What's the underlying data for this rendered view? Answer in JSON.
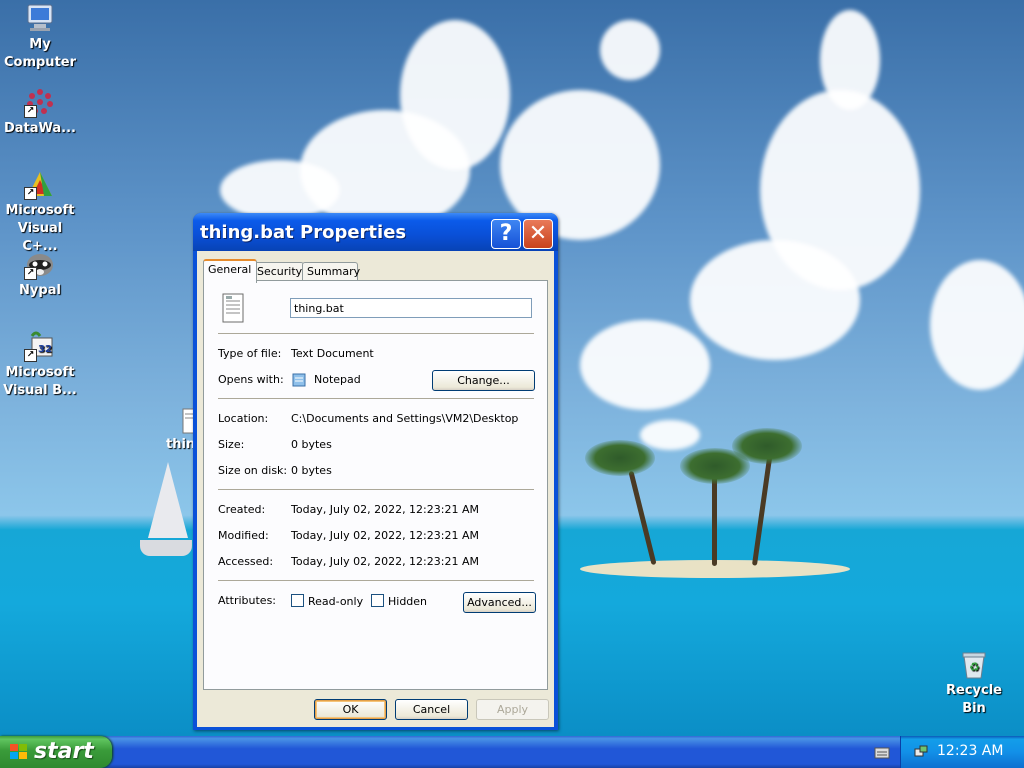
{
  "desktop": {
    "icons": [
      {
        "label": "My Computer",
        "name": "my-computer"
      },
      {
        "label": "DataWa...",
        "name": "datawa"
      },
      {
        "label": "Microsoft Visual C+...",
        "name": "visual-cpp"
      },
      {
        "label": "Nypal",
        "name": "nypal"
      },
      {
        "label": "Microsoft Visual B...",
        "name": "visual-basic"
      },
      {
        "label": "thin",
        "name": "thing-bat"
      },
      {
        "label": "Recycle Bin",
        "name": "recycle-bin"
      }
    ]
  },
  "dialog": {
    "title": "thing.bat Properties",
    "help_glyph": "?",
    "close_glyph": "✕",
    "tabs": [
      "General",
      "Security",
      "Summary"
    ],
    "active_tab": "General",
    "filename": "thing.bat",
    "type_label": "Type of file:",
    "type_value": "Text Document",
    "opens_label": "Opens with:",
    "opens_value": "Notepad",
    "change_button": "Change...",
    "location_label": "Location:",
    "location_value": "C:\\Documents and Settings\\VM2\\Desktop",
    "size_label": "Size:",
    "size_value": "0 bytes",
    "size_disk_label": "Size on disk:",
    "size_disk_value": "0 bytes",
    "created_label": "Created:",
    "created_value": "Today, July 02, 2022, 12:23:21 AM",
    "modified_label": "Modified:",
    "modified_value": "Today, July 02, 2022, 12:23:21 AM",
    "accessed_label": "Accessed:",
    "accessed_value": "Today, July 02, 2022, 12:23:21 AM",
    "attributes_label": "Attributes:",
    "readonly_label": "Read-only",
    "hidden_label": "Hidden",
    "advanced_button": "Advanced...",
    "ok_button": "OK",
    "cancel_button": "Cancel",
    "apply_button": "Apply"
  },
  "taskbar": {
    "start_label": "start",
    "clock": "12:23 AM"
  },
  "colors": {
    "titlebar": "#0a51d8",
    "dialog_bg": "#ece9d8",
    "taskbar": "#2157d7",
    "start": "#3a9b3a"
  }
}
